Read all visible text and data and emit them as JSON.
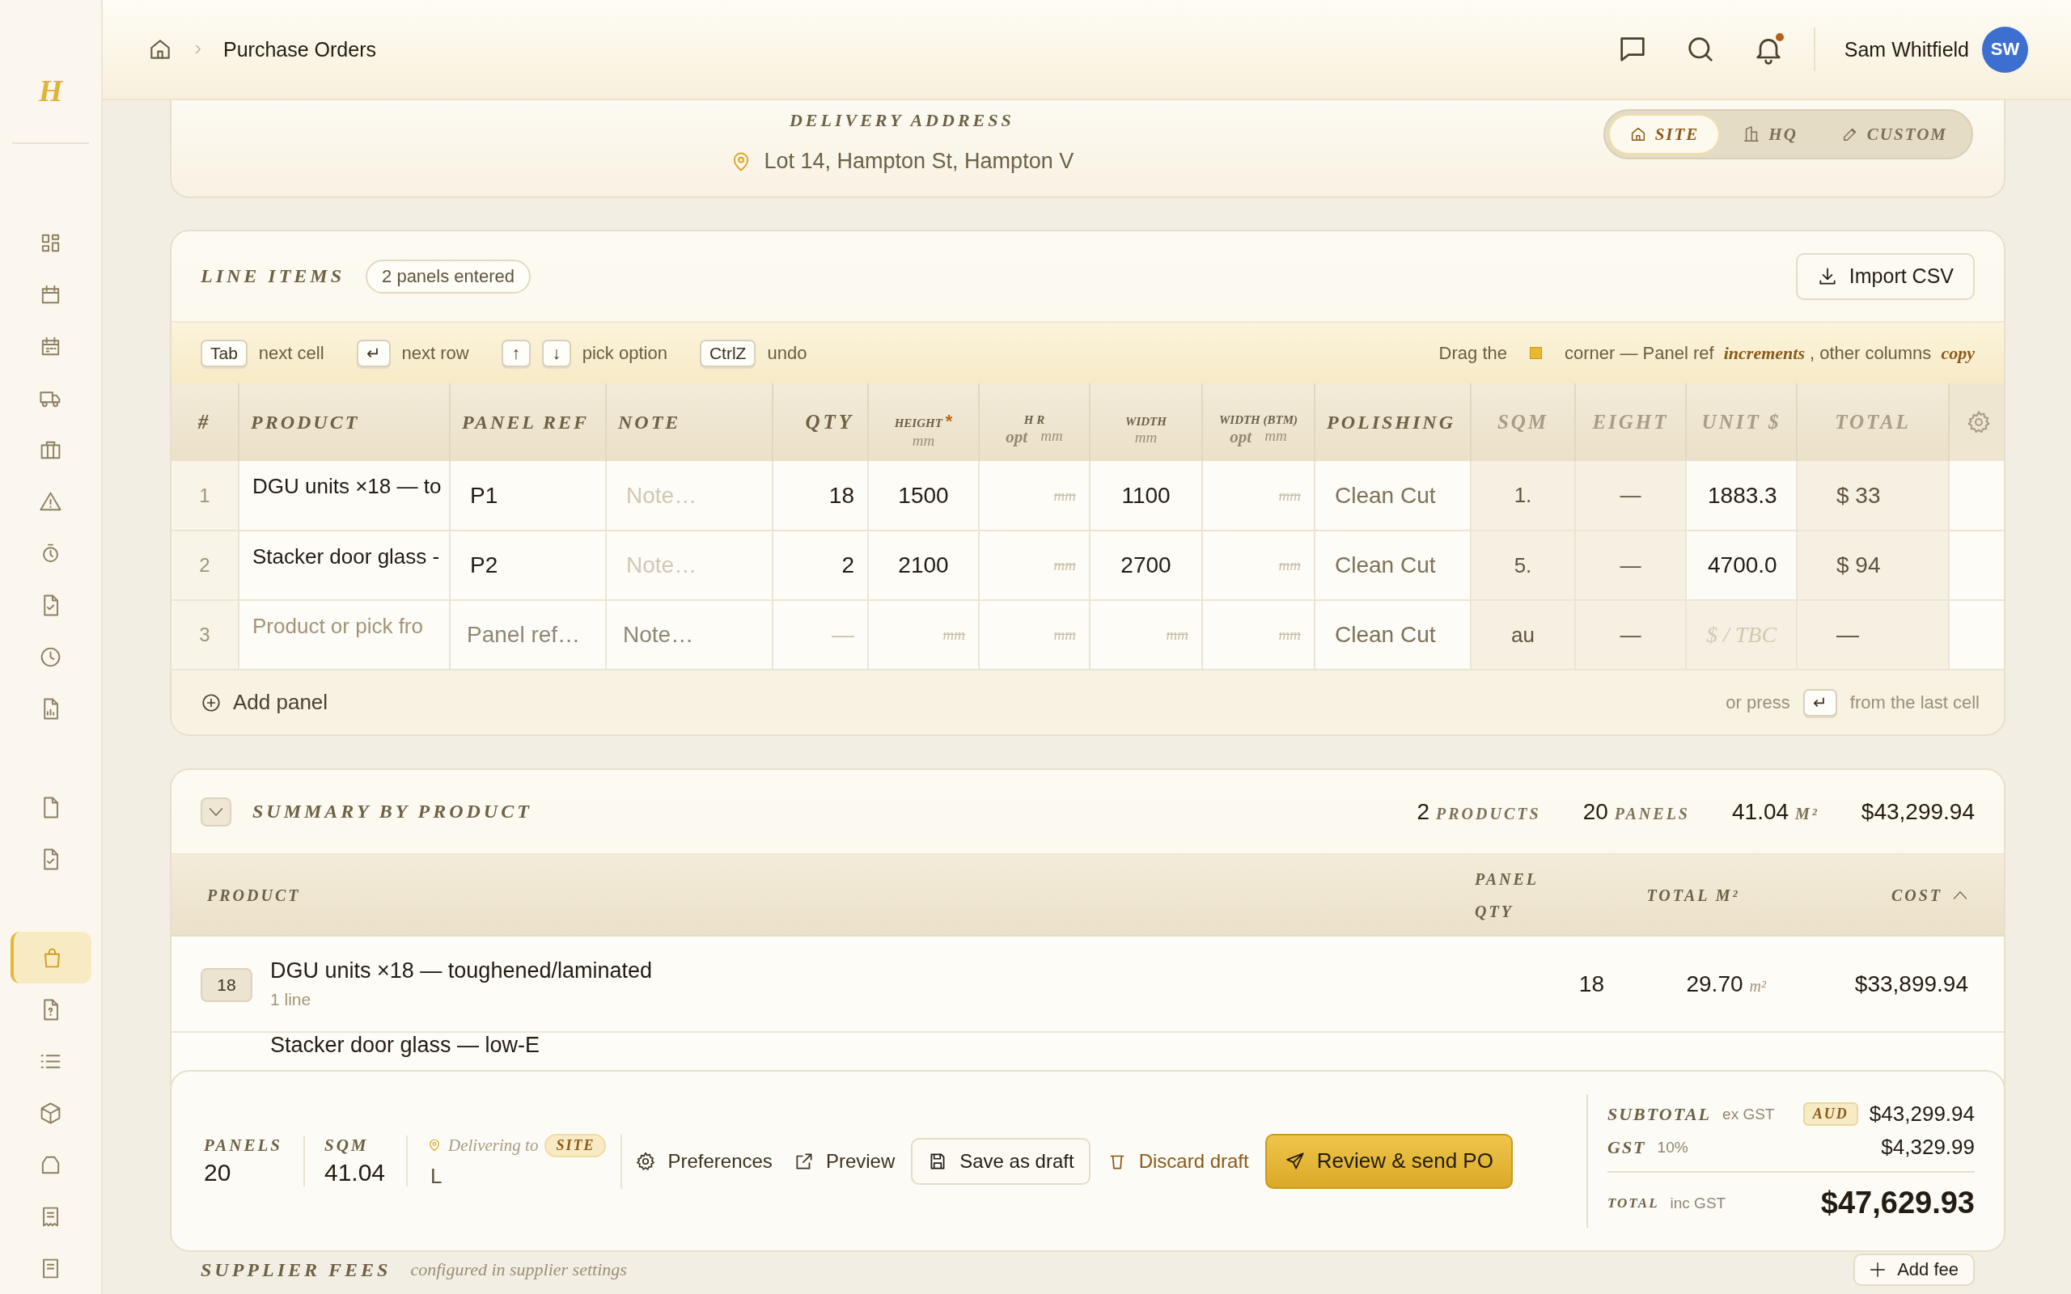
{
  "sidebar": {
    "logo": "H",
    "groups": [
      {
        "items": [
          {
            "kind": "grid",
            "selected": false
          },
          {
            "kind": "calendar",
            "selected": false
          },
          {
            "kind": "planner",
            "selected": false
          },
          {
            "kind": "truck",
            "selected": false
          },
          {
            "kind": "briefcase",
            "selected": false
          },
          {
            "kind": "warning",
            "selected": false
          },
          {
            "kind": "stopwatch",
            "selected": false
          },
          {
            "kind": "file-check",
            "selected": false
          },
          {
            "kind": "clock",
            "selected": false
          },
          {
            "kind": "file-chart",
            "selected": false
          }
        ]
      },
      {
        "items": [
          {
            "kind": "file",
            "selected": false
          },
          {
            "kind": "file-check",
            "selected": false
          }
        ]
      },
      {
        "items": [
          {
            "kind": "bag",
            "selected": true
          },
          {
            "kind": "file-question",
            "selected": false
          },
          {
            "kind": "list",
            "selected": false
          },
          {
            "kind": "cube",
            "selected": false
          },
          {
            "kind": "box",
            "selected": false
          },
          {
            "kind": "receipt",
            "selected": false
          },
          {
            "kind": "document",
            "selected": false
          }
        ]
      }
    ]
  },
  "topbar": {
    "breadcrumb": [
      "Purchase Orders"
    ],
    "notification": true,
    "user": {
      "name": "Sam Whitfield",
      "initials": "SW"
    }
  },
  "delivery": {
    "title": "DELIVERY ADDRESS",
    "address": "Lot 14, Hampton St, Hampton V",
    "options": [
      {
        "kind": "site",
        "label": "SITE",
        "selected": true
      },
      {
        "kind": "hq",
        "label": "HQ",
        "selected": false
      },
      {
        "kind": "custom",
        "label": "CUSTOM",
        "selected": false
      }
    ]
  },
  "line_items": {
    "title": "LINE ITEMS",
    "badge": "2 panels entered",
    "import_button": "Import CSV",
    "hints": [
      {
        "keys": [
          "Tab"
        ],
        "text": "next cell"
      },
      {
        "keys": [
          "↵"
        ],
        "text": "next row"
      },
      {
        "keys": [
          "↑",
          "↓"
        ],
        "text": "pick option"
      },
      {
        "keys": [
          "CtrlZ"
        ],
        "text": "undo"
      }
    ],
    "drag_hint": {
      "before": "Drag the",
      "after": "corner — Panel ref *increments*, other columns *copy*"
    },
    "columns": [
      {
        "label": "#",
        "kind": "index"
      },
      {
        "label": "PRODUCT",
        "kind": "text"
      },
      {
        "label": "PANEL REF",
        "kind": "text"
      },
      {
        "label": "NOTE",
        "kind": "text"
      },
      {
        "label": "QTY",
        "kind": "number"
      },
      {
        "label": "HEIGHT",
        "mark": "*",
        "unit": "mm",
        "kind": "dimension"
      },
      {
        "label": "H R",
        "optional": "opt",
        "unit": "mm",
        "kind": "dimension"
      },
      {
        "label": "WIDTH",
        "unit": "mm",
        "kind": "dimension"
      },
      {
        "label": "WIDTH (BTM)",
        "optional": "opt",
        "unit": "mm",
        "kind": "dimension"
      },
      {
        "label": "POLISHING",
        "kind": "text"
      },
      {
        "label": "SQM",
        "kind": "computed"
      },
      {
        "label": "EIGHT",
        "kind": "computed"
      },
      {
        "label": "UNIT $",
        "kind": "computed"
      },
      {
        "label": "TOTAL",
        "kind": "computed"
      }
    ],
    "rows": [
      {
        "cells": [
          {
            "text": "1",
            "kind": "rownum"
          },
          {
            "text": "DGU units ×18 — to",
            "kind": "product"
          },
          {
            "text": "P1",
            "kind": "text"
          },
          {
            "text": "Note…",
            "kind": "faint"
          },
          {
            "text": "18",
            "kind": "num"
          },
          {
            "text": "1500",
            "kind": "center"
          },
          {
            "text": "mm",
            "kind": "unit"
          },
          {
            "text": "1100",
            "kind": "center"
          },
          {
            "text": "mm",
            "kind": "unit"
          },
          {
            "text": "Clean Cut",
            "kind": "select"
          },
          {
            "text": "1.",
            "kind": "computed"
          },
          {
            "text": "—",
            "kind": "computed"
          },
          {
            "text": "1883.3",
            "kind": "price"
          },
          {
            "text": "$ 33",
            "kind": "total"
          }
        ]
      },
      {
        "cells": [
          {
            "text": "2",
            "kind": "rownum"
          },
          {
            "text": "Stacker door glass -",
            "kind": "product"
          },
          {
            "text": "P2",
            "kind": "text"
          },
          {
            "text": "Note…",
            "kind": "faint"
          },
          {
            "text": "2",
            "kind": "num"
          },
          {
            "text": "2100",
            "kind": "center"
          },
          {
            "text": "mm",
            "kind": "unit"
          },
          {
            "text": "2700",
            "kind": "center"
          },
          {
            "text": "mm",
            "kind": "unit"
          },
          {
            "text": "Clean Cut",
            "kind": "select"
          },
          {
            "text": "5.",
            "kind": "computed"
          },
          {
            "text": "—",
            "kind": "computed"
          },
          {
            "text": "4700.0",
            "kind": "price"
          },
          {
            "text": "$ 94",
            "kind": "total"
          }
        ]
      },
      {
        "cells": [
          {
            "text": "3",
            "kind": "rownum"
          },
          {
            "text": "Product or pick fro",
            "kind": "product-placeholder"
          },
          {
            "text": "Panel ref…",
            "kind": "placeholder"
          },
          {
            "text": "Note…",
            "kind": "placeholder"
          },
          {
            "text": "—",
            "kind": "dash"
          },
          {
            "text": "mm",
            "kind": "unit"
          },
          {
            "text": "mm",
            "kind": "unit"
          },
          {
            "text": "mm",
            "kind": "unit"
          },
          {
            "text": "mm",
            "kind": "unit"
          },
          {
            "text": "Clean Cut",
            "kind": "select"
          },
          {
            "text": "au",
            "kind": "computed"
          },
          {
            "text": "—",
            "kind": "computed"
          },
          {
            "text": "$ / TBC",
            "kind": "price-empty"
          },
          {
            "text": "—",
            "kind": "total"
          }
        ]
      }
    ],
    "add_button": "Add panel",
    "footer_hint": {
      "before": "or press",
      "key": "↵",
      "after": "from the last cell"
    }
  },
  "summary": {
    "title": "SUMMARY BY PRODUCT",
    "expanded": true,
    "stats": [
      {
        "value": "2",
        "label": "PRODUCTS"
      },
      {
        "value": "20",
        "label": "PANELS"
      },
      {
        "value": "41.04",
        "label": "M²"
      },
      {
        "value": "$43,299.94"
      }
    ],
    "columns": [
      "PRODUCT",
      "PANEL QTY",
      "TOTAL M²",
      "COST"
    ],
    "rows": [
      {
        "badge": "18",
        "name": "DGU units ×18 — toughened/laminated",
        "sub": "1 line",
        "qty": "18",
        "area": "29.70",
        "unit": "m²",
        "cost": "$33,899.94"
      },
      {
        "name": "Stacker door glass — low-E"
      }
    ]
  },
  "footer_bar": {
    "stats": [
      {
        "label": "PANELS",
        "value": "20"
      },
      {
        "label": "SQM",
        "value": "41.04"
      }
    ],
    "delivery": {
      "label": "Delivering to",
      "badge": "SITE",
      "value": "L"
    },
    "actions": [
      {
        "kind": "settings",
        "label": "Preferences"
      },
      {
        "kind": "preview",
        "label": "Preview"
      },
      {
        "kind": "save",
        "label": "Save as draft"
      },
      {
        "kind": "discard",
        "label": "Discard draft"
      },
      {
        "kind": "primary",
        "label": "Review & send PO"
      }
    ],
    "totals": [
      {
        "kind": "subtotal",
        "label": "SUBTOTAL",
        "note": "ex GST",
        "badge": "AUD",
        "value": "$43,299.94"
      },
      {
        "kind": "tax",
        "label": "GST",
        "note": "10%",
        "value": "$4,329.99"
      },
      {
        "kind": "grand",
        "label": "TOTAL",
        "note": "inc GST",
        "value": "$47,629.93"
      }
    ]
  },
  "supplier_fees": {
    "title": "SUPPLIER FEES",
    "note": "configured in supplier settings",
    "button": "Add fee"
  }
}
